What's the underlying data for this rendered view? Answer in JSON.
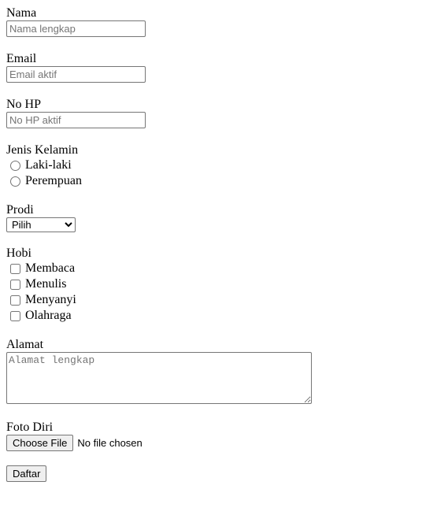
{
  "form": {
    "nama": {
      "label": "Nama",
      "placeholder": "Nama lengkap",
      "value": ""
    },
    "email": {
      "label": "Email",
      "placeholder": "Email aktif",
      "value": ""
    },
    "no_hp": {
      "label": "No HP",
      "placeholder": "No HP aktif",
      "value": ""
    },
    "jenis_kelamin": {
      "label": "Jenis Kelamin",
      "options": [
        "Laki-laki",
        "Perempuan"
      ]
    },
    "prodi": {
      "label": "Prodi",
      "selected": "Pilih"
    },
    "hobi": {
      "label": "Hobi",
      "options": [
        "Membaca",
        "Menulis",
        "Menyanyi",
        "Olahraga"
      ]
    },
    "alamat": {
      "label": "Alamat",
      "placeholder": "Alamat lengkap",
      "value": ""
    },
    "foto_diri": {
      "label": "Foto Diri",
      "button_label": "Choose File",
      "status": "No file chosen"
    },
    "submit_label": "Daftar"
  },
  "colors": {
    "background": "#ffffff",
    "text": "#000000",
    "placeholder": "#757575",
    "border": "#767676",
    "button_bg": "#efefef"
  }
}
